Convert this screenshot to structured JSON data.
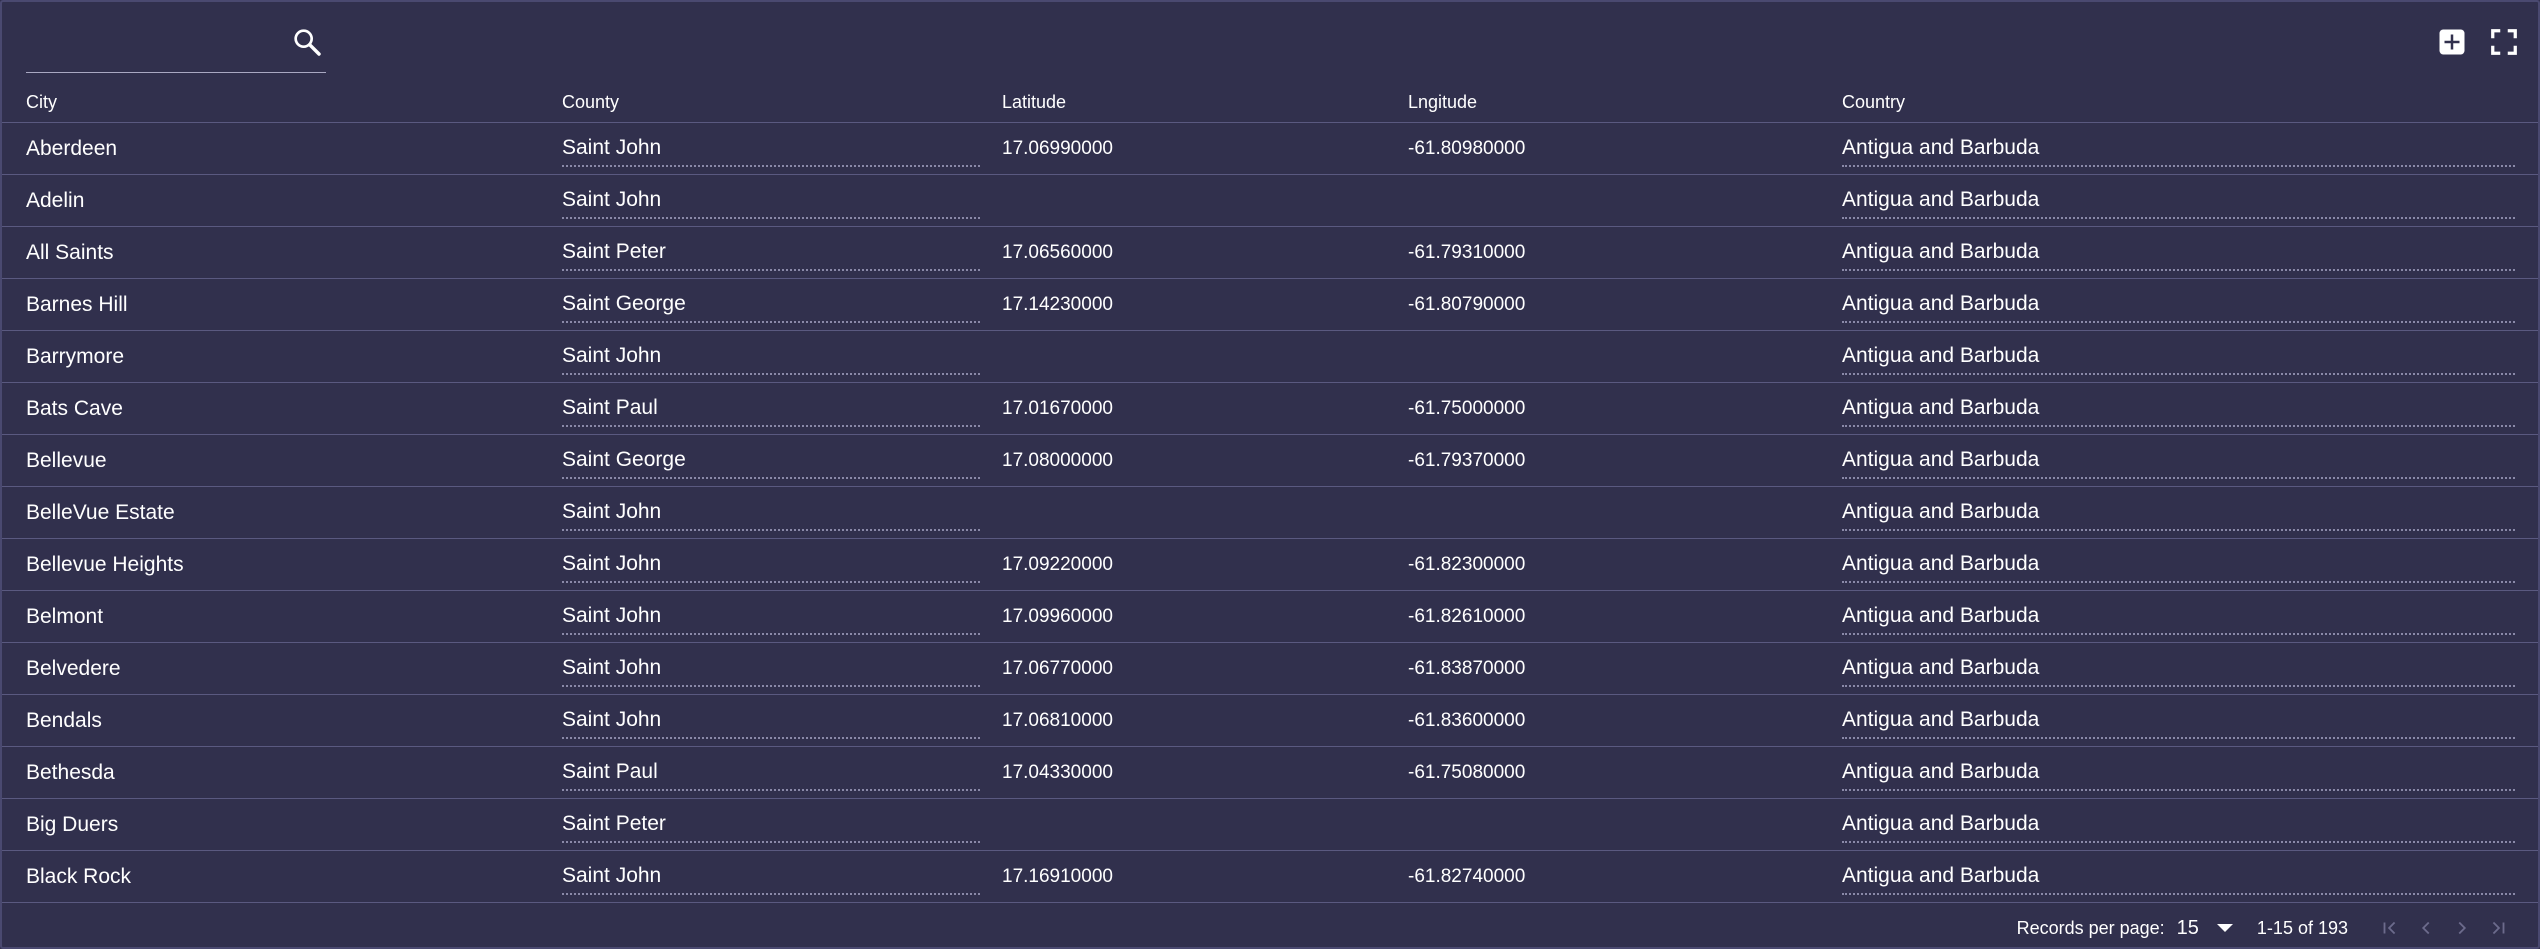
{
  "search": {
    "value": "",
    "placeholder": ""
  },
  "columns": {
    "city": "City",
    "county": "County",
    "latitude": "Latitude",
    "longitude": "Lngitude",
    "country": "Country"
  },
  "rows": [
    {
      "city": "Aberdeen",
      "county": "Saint John",
      "lat": "17.06990000",
      "lng": "-61.80980000",
      "country": "Antigua and Barbuda"
    },
    {
      "city": "Adelin",
      "county": "Saint John",
      "lat": "",
      "lng": "",
      "country": "Antigua and Barbuda"
    },
    {
      "city": "All Saints",
      "county": "Saint Peter",
      "lat": "17.06560000",
      "lng": "-61.79310000",
      "country": "Antigua and Barbuda"
    },
    {
      "city": "Barnes Hill",
      "county": "Saint George",
      "lat": "17.14230000",
      "lng": "-61.80790000",
      "country": "Antigua and Barbuda"
    },
    {
      "city": "Barrymore",
      "county": "Saint John",
      "lat": "",
      "lng": "",
      "country": "Antigua and Barbuda"
    },
    {
      "city": "Bats Cave",
      "county": "Saint Paul",
      "lat": "17.01670000",
      "lng": "-61.75000000",
      "country": "Antigua and Barbuda"
    },
    {
      "city": "Bellevue",
      "county": "Saint George",
      "lat": "17.08000000",
      "lng": "-61.79370000",
      "country": "Antigua and Barbuda"
    },
    {
      "city": "BelleVue Estate",
      "county": "Saint John",
      "lat": "",
      "lng": "",
      "country": "Antigua and Barbuda"
    },
    {
      "city": "Bellevue Heights",
      "county": "Saint John",
      "lat": "17.09220000",
      "lng": "-61.82300000",
      "country": "Antigua and Barbuda"
    },
    {
      "city": "Belmont",
      "county": "Saint John",
      "lat": "17.09960000",
      "lng": "-61.82610000",
      "country": "Antigua and Barbuda"
    },
    {
      "city": "Belvedere",
      "county": "Saint John",
      "lat": "17.06770000",
      "lng": "-61.83870000",
      "country": "Antigua and Barbuda"
    },
    {
      "city": "Bendals",
      "county": "Saint John",
      "lat": "17.06810000",
      "lng": "-61.83600000",
      "country": "Antigua and Barbuda"
    },
    {
      "city": "Bethesda",
      "county": "Saint Paul",
      "lat": "17.04330000",
      "lng": "-61.75080000",
      "country": "Antigua and Barbuda"
    },
    {
      "city": "Big Duers",
      "county": "Saint Peter",
      "lat": "",
      "lng": "",
      "country": "Antigua and Barbuda"
    },
    {
      "city": "Black Rock",
      "county": "Saint John",
      "lat": "17.16910000",
      "lng": "-61.82740000",
      "country": "Antigua and Barbuda"
    }
  ],
  "footer": {
    "records_per_page_label": "Records per page:",
    "records_per_page_value": "15",
    "range_text": "1-15 of 193"
  },
  "icons": {
    "search": "search-icon",
    "add": "plus-box-icon",
    "fullscreen": "fullscreen-icon",
    "first": "first-page-icon",
    "prev": "chevron-left-icon",
    "next": "chevron-right-icon",
    "last": "last-page-icon"
  },
  "colors": {
    "background": "#31304d",
    "text": "#ffffff",
    "divider": "#5a5980",
    "disabled": "#6c6b8c"
  }
}
